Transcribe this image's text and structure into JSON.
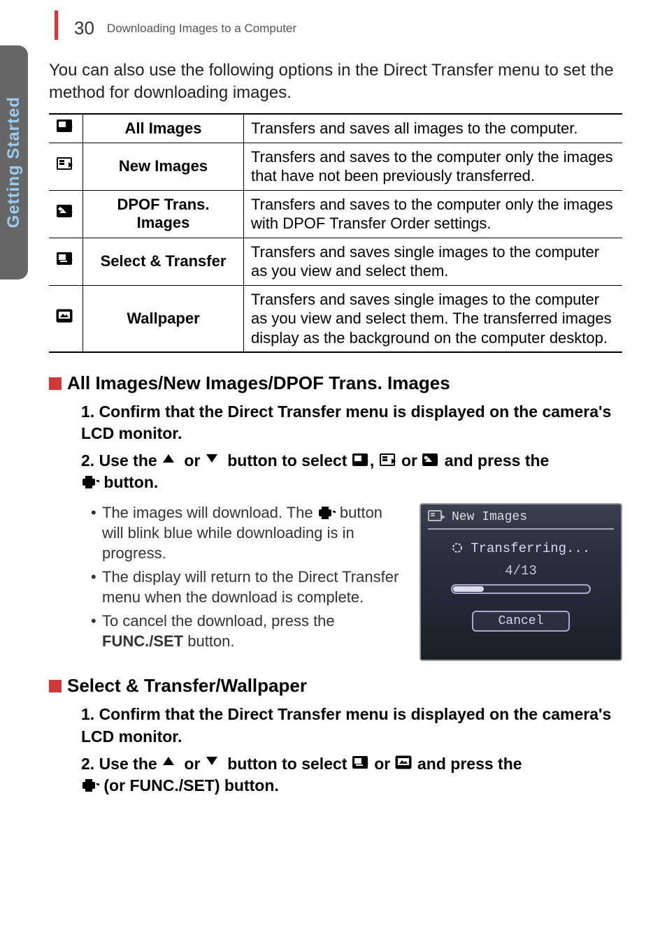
{
  "header": {
    "page_number": "30",
    "title": "Downloading Images to a Computer"
  },
  "side_tab": "Getting Started",
  "intro": "You can also use the following options in the Direct Transfer menu to set the method for downloading images.",
  "table": {
    "rows": [
      {
        "icon": "all-images-icon",
        "label": "All Images",
        "desc": "Transfers and saves all images to the computer."
      },
      {
        "icon": "new-images-icon",
        "label": "New Images",
        "desc": "Transfers and saves to the computer only the images that have not been previously transferred."
      },
      {
        "icon": "dpof-icon",
        "label": "DPOF Trans. Images",
        "desc": "Transfers and saves to the computer only the images with DPOF Transfer Order settings."
      },
      {
        "icon": "select-transfer-icon",
        "label": "Select & Transfer",
        "desc": "Transfers and saves single images to the computer as you view and select them."
      },
      {
        "icon": "wallpaper-icon",
        "label": "Wallpaper",
        "desc": "Transfers and saves single images to the computer as you view and select them. The transferred images display as the background on the computer desktop."
      }
    ]
  },
  "section1": {
    "heading": "All Images/New Images/DPOF Trans. Images",
    "step1": "1. Confirm that the Direct Transfer menu is displayed on the camera's LCD monitor.",
    "step2_pre": "2. Use the ",
    "step2_mid1": " or ",
    "step2_mid2": " button to select ",
    "step2_sep": ", ",
    "step2_mid3": " or ",
    "step2_mid4": " and press the ",
    "step2_end": " button.",
    "bullets": [
      {
        "pre": "The images will download. The ",
        "post": " button will blink blue while downloading is in progress."
      },
      {
        "text": "The display will return to the Direct Transfer menu when the download is complete."
      },
      {
        "pre": "To cancel the download, press the ",
        "bold": "FUNC./SET",
        "post": " button."
      }
    ]
  },
  "camera_ui": {
    "title": "New Images",
    "status": "Transferring...",
    "count": "4/13",
    "cancel": "Cancel"
  },
  "section2": {
    "heading": "Select & Transfer/Wallpaper",
    "step1": "1. Confirm that the Direct Transfer menu is displayed on the camera's LCD monitor.",
    "step2_pre": "2. Use the ",
    "step2_mid1": " or ",
    "step2_mid2": " button to select ",
    "step2_mid3": " or ",
    "step2_mid4": " and press the ",
    "step2_end": " (or FUNC./SET) button."
  }
}
